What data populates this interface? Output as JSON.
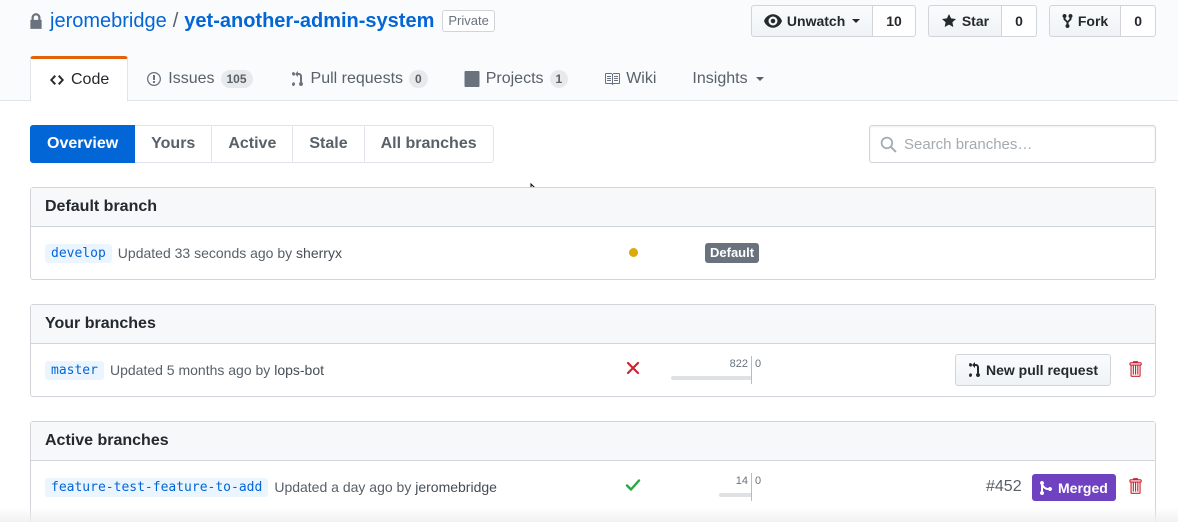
{
  "repo": {
    "owner": "jeromebridge",
    "separator": "/",
    "name": "yet-another-admin-system",
    "visibility": "Private"
  },
  "actions": {
    "watch": {
      "label": "Unwatch",
      "count": "10"
    },
    "star": {
      "label": "Star",
      "count": "0"
    },
    "fork": {
      "label": "Fork",
      "count": "0"
    }
  },
  "tabs": [
    {
      "label": "Code",
      "icon": "code-icon",
      "selected": true
    },
    {
      "label": "Issues",
      "icon": "issue-icon",
      "count": "105"
    },
    {
      "label": "Pull requests",
      "icon": "pull-request-icon",
      "count": "0"
    },
    {
      "label": "Projects",
      "icon": "project-icon",
      "count": "1"
    },
    {
      "label": "Wiki",
      "icon": "book-icon"
    },
    {
      "label": "Insights",
      "icon": "chevron-down-icon"
    }
  ],
  "filters": {
    "items": [
      "Overview",
      "Yours",
      "Active",
      "Stale",
      "All branches"
    ],
    "selected": "Overview"
  },
  "search": {
    "placeholder": "Search branches…",
    "value": ""
  },
  "sections": {
    "default": {
      "title": "Default branch",
      "branch": "develop",
      "updated": "Updated 33 seconds ago by",
      "author": "sherryx",
      "status": "pending",
      "label": "Default"
    },
    "yours": {
      "title": "Your branches",
      "branch": "master",
      "updated": "Updated 5 months ago by",
      "author": "lops-bot",
      "status": "failure",
      "behind": "822",
      "ahead": "0",
      "behind_fraction": 1.0,
      "button": "New pull request"
    },
    "active": {
      "title": "Active branches",
      "branch": "feature-test-feature-to-add",
      "updated": "Updated a day ago by",
      "author": "jeromebridge",
      "status": "success",
      "behind": "14",
      "ahead": "0",
      "behind_fraction": 0.4,
      "pr_number": "#452",
      "pr_state": "Merged"
    }
  },
  "colors": {
    "link": "#0366d6",
    "pending": "#dbab09",
    "failure": "#cb2431",
    "success": "#28a745",
    "merged": "#6f42c1",
    "tab_accent": "#e36209"
  }
}
